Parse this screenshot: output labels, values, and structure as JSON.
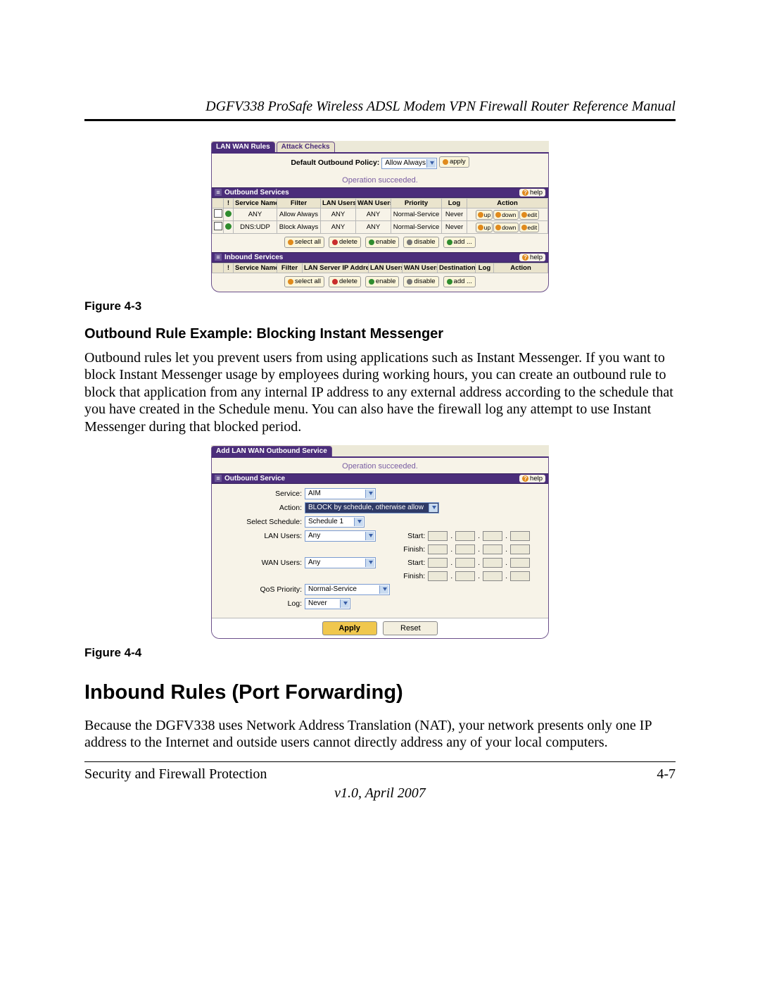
{
  "header_title": "DGFV338 ProSafe Wireless ADSL Modem VPN Firewall Router Reference Manual",
  "fig3_caption": "Figure 4-3",
  "fig4_caption": "Figure 4-4",
  "sub_heading": "Outbound Rule Example: Blocking Instant Messenger",
  "para1": "Outbound rules let you prevent users from using applications such as Instant Messenger. If you want to block Instant Messenger usage by employees during working hours, you can create an outbound rule to block that application from any internal IP address to any external address according to the schedule that you have created in the Schedule menu. You can also have the firewall log any attempt to use Instant Messenger during that blocked period.",
  "main_heading": "Inbound Rules (Port Forwarding)",
  "para2": "Because the DGFV338 uses Network Address Translation (NAT), your network presents only one IP address to the Internet and outside users cannot directly address any of your local computers.",
  "footer_left": "Security and Firewall Protection",
  "footer_right": "4-7",
  "version_line": "v1.0, April 2007",
  "fig3": {
    "tabs": {
      "active": "LAN WAN Rules",
      "other": "Attack Checks"
    },
    "default_policy_label": "Default Outbound Policy:",
    "default_policy_value": "Allow Always",
    "apply_btn": "apply",
    "status": "Operation succeeded.",
    "help": "help",
    "outbound_section": "Outbound Services",
    "inbound_section": "Inbound Services",
    "out_cols": {
      "c1": "!",
      "c2": "Service Name",
      "c3": "Filter",
      "c4": "LAN Users",
      "c5": "WAN Users",
      "c6": "Priority",
      "c7": "Log",
      "c8": "Action"
    },
    "out_rows": [
      {
        "svc": "ANY",
        "filter": "Allow Always",
        "lan": "ANY",
        "wan": "ANY",
        "pri": "Normal-Service",
        "log": "Never"
      },
      {
        "svc": "DNS:UDP",
        "filter": "Block Always",
        "lan": "ANY",
        "wan": "ANY",
        "pri": "Normal-Service",
        "log": "Never"
      }
    ],
    "row_btns": {
      "up": "up",
      "down": "down",
      "edit": "edit"
    },
    "btn_row": {
      "select_all": "select all",
      "delete": "delete",
      "enable": "enable",
      "disable": "disable",
      "add": "add ..."
    },
    "in_cols": {
      "c1": "!",
      "c2": "Service Name",
      "c3": "Filter",
      "c4": "LAN Server IP Address",
      "c5": "LAN Users",
      "c6": "WAN Users",
      "c7": "Destination",
      "c8": "Log",
      "c9": "Action"
    }
  },
  "fig4": {
    "tab": "Add LAN WAN Outbound Service",
    "status": "Operation succeeded.",
    "section": "Outbound Service",
    "help": "help",
    "labels": {
      "service": "Service:",
      "action": "Action:",
      "schedule": "Select Schedule:",
      "lan": "LAN Users:",
      "wan": "WAN Users:",
      "qos": "QoS Priority:",
      "log": "Log:",
      "start": "Start:",
      "finish": "Finish:"
    },
    "values": {
      "service": "AIM",
      "action": "BLOCK by schedule, otherwise allow",
      "schedule": "Schedule 1",
      "lan": "Any",
      "wan": "Any",
      "qos": "Normal-Service",
      "log": "Never"
    },
    "apply": "Apply",
    "reset": "Reset"
  }
}
